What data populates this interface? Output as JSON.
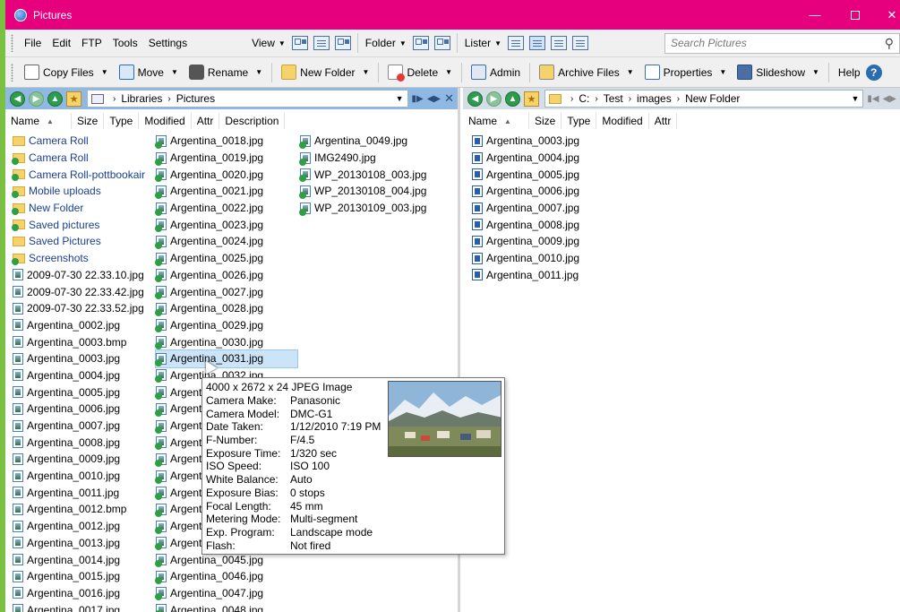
{
  "window": {
    "title": "Pictures"
  },
  "menubar": {
    "items": [
      "File",
      "Edit",
      "FTP",
      "Tools",
      "Settings"
    ],
    "view_label": "View",
    "folder_label": "Folder",
    "lister_label": "Lister",
    "search_placeholder": "Search Pictures"
  },
  "actions": {
    "copy": "Copy Files",
    "move": "Move",
    "rename": "Rename",
    "new_folder": "New Folder",
    "delete": "Delete",
    "admin": "Admin",
    "archive": "Archive Files",
    "properties": "Properties",
    "slideshow": "Slideshow",
    "help": "Help",
    "help_glyph": "?"
  },
  "left_pane": {
    "path": [
      "Libraries",
      "Pictures"
    ],
    "columns": [
      "Name",
      "Size",
      "Type",
      "Modified",
      "Attr",
      "Description"
    ],
    "col1": [
      {
        "name": "Camera Roll",
        "icon": "folder"
      },
      {
        "name": "Camera Roll",
        "icon": "folder-sync"
      },
      {
        "name": "Camera Roll-pottbookair",
        "icon": "folder-sync"
      },
      {
        "name": "Mobile uploads",
        "icon": "folder-sync"
      },
      {
        "name": "New Folder",
        "icon": "folder-sync"
      },
      {
        "name": "Saved pictures",
        "icon": "folder-sync"
      },
      {
        "name": "Saved Pictures",
        "icon": "folder"
      },
      {
        "name": "Screenshots",
        "icon": "folder-sync"
      },
      {
        "name": "2009-07-30 22.33.10.jpg",
        "icon": "img"
      },
      {
        "name": "2009-07-30 22.33.42.jpg",
        "icon": "img"
      },
      {
        "name": "2009-07-30 22.33.52.jpg",
        "icon": "img"
      },
      {
        "name": "Argentina_0002.jpg",
        "icon": "img"
      },
      {
        "name": "Argentina_0003.bmp",
        "icon": "img"
      },
      {
        "name": "Argentina_0003.jpg",
        "icon": "img"
      },
      {
        "name": "Argentina_0004.jpg",
        "icon": "img"
      },
      {
        "name": "Argentina_0005.jpg",
        "icon": "img"
      },
      {
        "name": "Argentina_0006.jpg",
        "icon": "img"
      },
      {
        "name": "Argentina_0007.jpg",
        "icon": "img"
      },
      {
        "name": "Argentina_0008.jpg",
        "icon": "img"
      },
      {
        "name": "Argentina_0009.jpg",
        "icon": "img"
      },
      {
        "name": "Argentina_0010.jpg",
        "icon": "img"
      },
      {
        "name": "Argentina_0011.jpg",
        "icon": "img"
      },
      {
        "name": "Argentina_0012.bmp",
        "icon": "img"
      },
      {
        "name": "Argentina_0012.jpg",
        "icon": "img"
      },
      {
        "name": "Argentina_0013.jpg",
        "icon": "img"
      },
      {
        "name": "Argentina_0014.jpg",
        "icon": "img"
      },
      {
        "name": "Argentina_0015.jpg",
        "icon": "img"
      },
      {
        "name": "Argentina_0016.jpg",
        "icon": "img"
      },
      {
        "name": "Argentina_0017.jpg",
        "icon": "img"
      }
    ],
    "col2": [
      {
        "name": "Argentina_0018.jpg"
      },
      {
        "name": "Argentina_0019.jpg"
      },
      {
        "name": "Argentina_0020.jpg"
      },
      {
        "name": "Argentina_0021.jpg"
      },
      {
        "name": "Argentina_0022.jpg"
      },
      {
        "name": "Argentina_0023.jpg"
      },
      {
        "name": "Argentina_0024.jpg"
      },
      {
        "name": "Argentina_0025.jpg"
      },
      {
        "name": "Argentina_0026.jpg"
      },
      {
        "name": "Argentina_0027.jpg"
      },
      {
        "name": "Argentina_0028.jpg"
      },
      {
        "name": "Argentina_0029.jpg"
      },
      {
        "name": "Argentina_0030.jpg"
      },
      {
        "name": "Argentina_0031.jpg",
        "hover": true
      },
      {
        "name": "Argentina_0032.jpg"
      },
      {
        "name": "Argentina_0033.jpg"
      },
      {
        "name": "Argentina_0034.jpg"
      },
      {
        "name": "Argentina_0035.jpg"
      },
      {
        "name": "Argentina_0036.jpg"
      },
      {
        "name": "Argentina_0037.jpg"
      },
      {
        "name": "Argentina_0038.jpg"
      },
      {
        "name": "Argentina_0039.jpg"
      },
      {
        "name": "Argentina_0040.jpg"
      },
      {
        "name": "Argentina_0041.jpg"
      },
      {
        "name": "Argentina_0042.jpg"
      },
      {
        "name": "Argentina_0045.jpg"
      },
      {
        "name": "Argentina_0046.jpg"
      },
      {
        "name": "Argentina_0047.jpg"
      },
      {
        "name": "Argentina_0048.jpg"
      }
    ],
    "col3": [
      {
        "name": "Argentina_0049.jpg"
      },
      {
        "name": "IMG2490.jpg"
      },
      {
        "name": "WP_20130108_003.jpg"
      },
      {
        "name": "WP_20130108_004.jpg"
      },
      {
        "name": "WP_20130109_003.jpg"
      }
    ]
  },
  "right_pane": {
    "path": [
      "C:",
      "Test",
      "images",
      "New Folder"
    ],
    "columns": [
      "Name",
      "Size",
      "Type",
      "Modified",
      "Attr"
    ],
    "files": [
      "Argentina_0003.jpg",
      "Argentina_0004.jpg",
      "Argentina_0005.jpg",
      "Argentina_0006.jpg",
      "Argentina_0007.jpg",
      "Argentina_0008.jpg",
      "Argentina_0009.jpg",
      "Argentina_0010.jpg",
      "Argentina_0011.jpg"
    ]
  },
  "tooltip": {
    "header": "4000 x 2672 x 24 JPEG Image",
    "rows": [
      {
        "label": "Camera Make:",
        "value": "Panasonic"
      },
      {
        "label": "Camera Model:",
        "value": "DMC-G1"
      },
      {
        "label": "Date Taken:",
        "value": "1/12/2010 7:19 PM"
      },
      {
        "label": "F-Number:",
        "value": "F/4.5"
      },
      {
        "label": "Exposure Time:",
        "value": "1/320 sec"
      },
      {
        "label": "ISO Speed:",
        "value": "ISO 100"
      },
      {
        "label": "White Balance:",
        "value": "Auto"
      },
      {
        "label": "Exposure Bias:",
        "value": "0 stops"
      },
      {
        "label": "Focal Length:",
        "value": "45 mm"
      },
      {
        "label": "Metering Mode:",
        "value": "Multi-segment"
      },
      {
        "label": "Exp. Program:",
        "value": "Landscape mode"
      },
      {
        "label": "Flash:",
        "value": "Not fired"
      }
    ]
  },
  "colors": {
    "titlebar": "#e6007e",
    "desktop": "#7ac143",
    "left_pathbar": "#8fb8e2",
    "folder_text": "#1a3f8f"
  }
}
